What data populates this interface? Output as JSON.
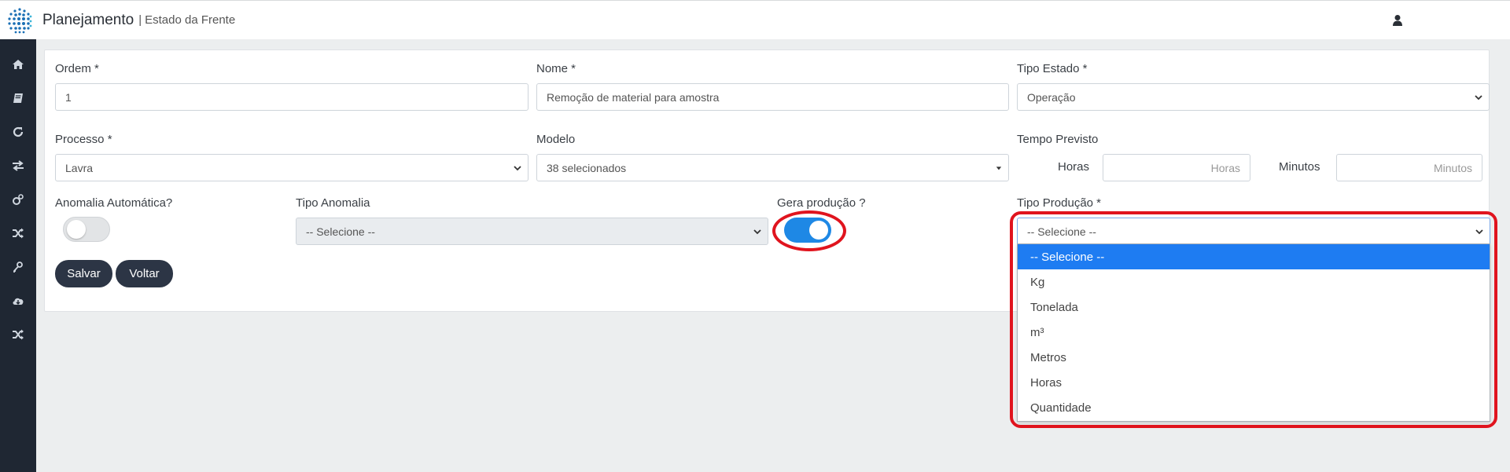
{
  "header": {
    "title": "Planejamento",
    "separator": "|",
    "subtitle": "Estado da Frente"
  },
  "icons": {
    "logo": "dots-logo",
    "user": "user-icon"
  },
  "sidebar": {
    "items": [
      {
        "icon": "home-icon"
      },
      {
        "icon": "book-icon"
      },
      {
        "icon": "refresh-icon"
      },
      {
        "icon": "exchange-icon"
      },
      {
        "icon": "gears-icon"
      },
      {
        "icon": "shuffle-icon"
      },
      {
        "icon": "key-icon"
      },
      {
        "icon": "cloud-download-icon"
      },
      {
        "icon": "shuffle-icon"
      }
    ]
  },
  "form": {
    "ordem": {
      "label": "Ordem *",
      "value": "1"
    },
    "nome": {
      "label": "Nome *",
      "value": "Remoção de material para amostra"
    },
    "tipo_estado": {
      "label": "Tipo Estado *",
      "value": "Operação"
    },
    "processo": {
      "label": "Processo *",
      "value": "Lavra"
    },
    "modelo": {
      "label": "Modelo",
      "value": "38 selecionados"
    },
    "tempo_previsto": {
      "label": "Tempo Previsto",
      "horas_label": "Horas",
      "horas_placeholder": "Horas",
      "minutos_label": "Minutos",
      "minutos_placeholder": "Minutos"
    },
    "anomalia_automatica": {
      "label": "Anomalia Automática?",
      "on": false
    },
    "tipo_anomalia": {
      "label": "Tipo Anomalia",
      "value": "-- Selecione --"
    },
    "gera_producao": {
      "label": "Gera produção ?",
      "on": true
    },
    "tipo_producao": {
      "label": "Tipo Produção *",
      "value": "-- Selecione --",
      "options": [
        "-- Selecione --",
        "Kg",
        "Tonelada",
        "m³",
        "Metros",
        "Horas",
        "Quantidade"
      ],
      "selected_index": 0
    }
  },
  "buttons": {
    "save": "Salvar",
    "back": "Voltar"
  },
  "colors": {
    "accent": "#1e88e5",
    "annotation": "#e0141e",
    "sidebar": "#1f2733",
    "button": "#2c3545"
  }
}
